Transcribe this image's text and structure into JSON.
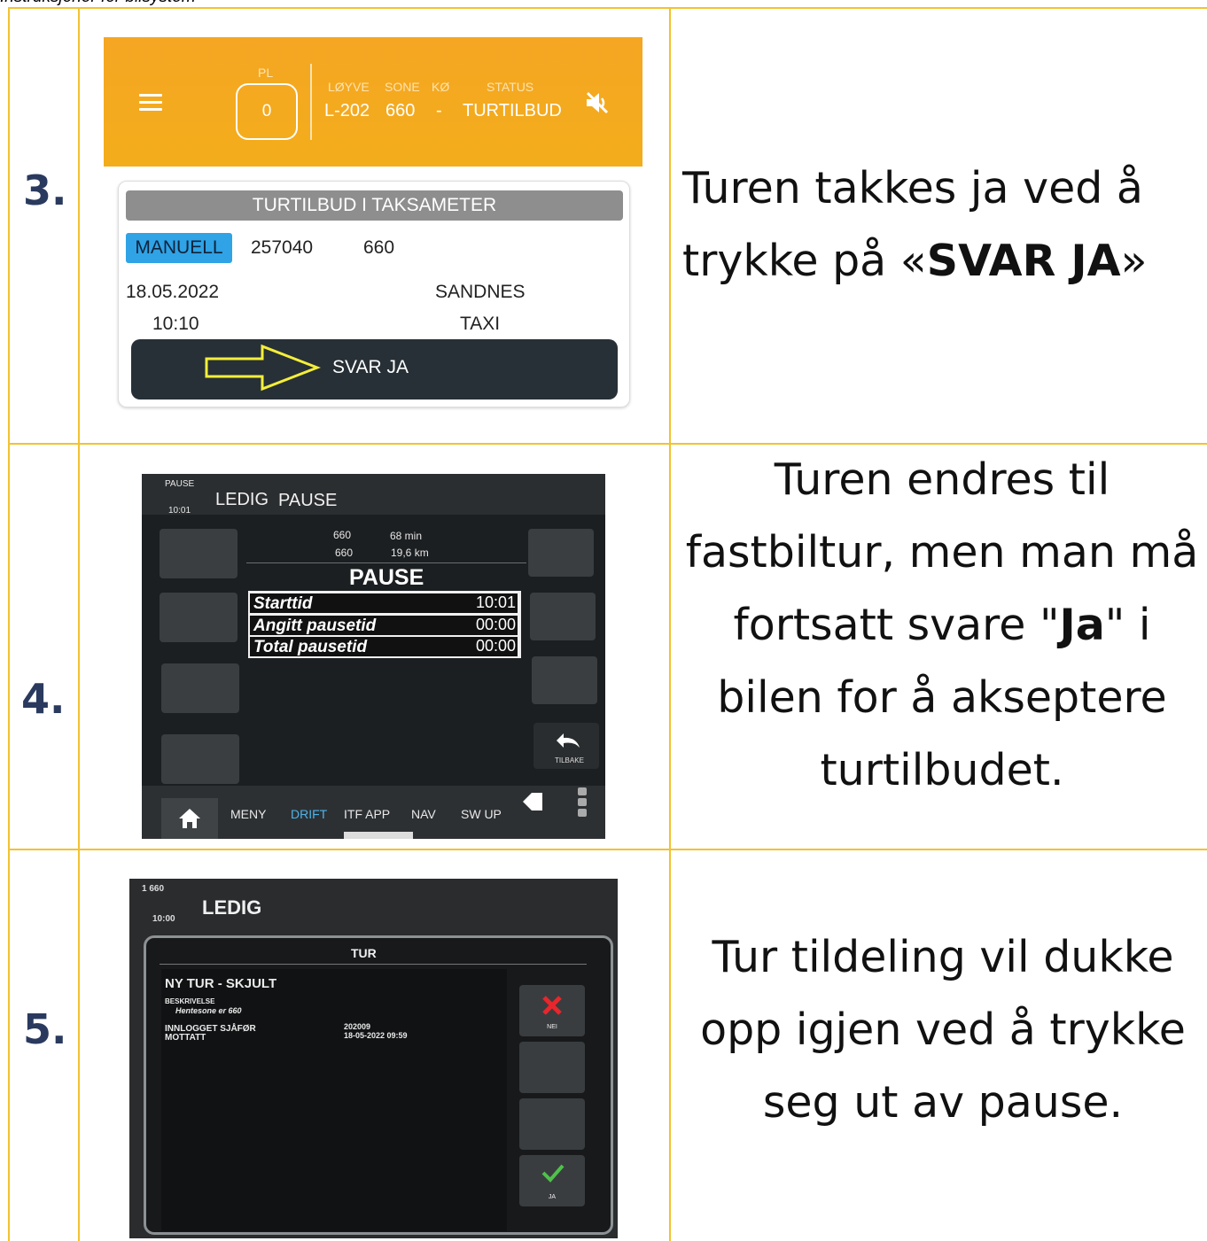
{
  "top_note": "Instruksjoner for bilsystem",
  "rows": [
    {
      "number": "3.",
      "description_parts": [
        "Turen takkes ja ved å trykke på «",
        "SVAR JA",
        "»"
      ],
      "screenshot": {
        "pl_label": "PL",
        "pl_value": "0",
        "header_labels": [
          "LØYVE",
          "SONE",
          "KØ",
          "STATUS"
        ],
        "header_values": [
          "L-202",
          "660",
          "-",
          "TURTILBUD"
        ],
        "card_title": "TURTILBUD I TAKSAMETER",
        "badge": "MANUELL",
        "trip_number": "257040",
        "zone": "660",
        "date": "18.05.2022",
        "time": "10:10",
        "company_line1": "SANDNES",
        "company_line2": "TAXI",
        "button_label": "SVAR JA",
        "icons": [
          "menu-icon",
          "mute-icon",
          "arrow-icon"
        ]
      }
    },
    {
      "number": "4.",
      "description_parts": [
        "Turen endres til fastbiltur, men man må fortsatt svare \"",
        "Ja",
        "\" i bilen for å akseptere turtilbudet."
      ],
      "screenshot": {
        "status_small": "PAUSE",
        "clock": "10:01",
        "top_status": "LEDIG",
        "top_mode": "PAUSE",
        "zone_a": "660",
        "zone_b": "660",
        "minutes": "68 min",
        "distance": "19,6 km",
        "headline": "PAUSE",
        "rows": [
          {
            "label": "Starttid",
            "value": "10:01"
          },
          {
            "label": "Angitt pausetid",
            "value": "00:00"
          },
          {
            "label": "Total pausetid",
            "value": "00:00"
          }
        ],
        "back_label": "TILBAKE",
        "tabs": [
          "MENY",
          "DRIFT",
          "ITF APP",
          "NAV",
          "SW UP"
        ],
        "active_tab_color": "#4fb3e8"
      }
    },
    {
      "number": "5.",
      "description_parts": [
        "Tur tildeling vil dukke opp igjen ved å trykke seg ut av pause."
      ],
      "screenshot": {
        "status_small_1": "1  660",
        "clock": "10:00",
        "top_status": "LEDIG",
        "dialog_title": "TUR",
        "heading": "NY TUR - SKJULT",
        "beskrivelse_label": "BESKRIVELSE",
        "beskrivelse_value": "Hentesone er 660",
        "driver_label": "INNLOGGET SJÅFØR",
        "received_label": "MOTTATT",
        "driver_value": "202009",
        "received_value": "18-05-2022 09:59",
        "no_label": "NEI",
        "yes_label": "JA"
      }
    }
  ],
  "colors": {
    "grid": "#f2c230",
    "number": "#2a3a5e",
    "appbar": "#f5a623",
    "badge": "#2fa3e6"
  }
}
